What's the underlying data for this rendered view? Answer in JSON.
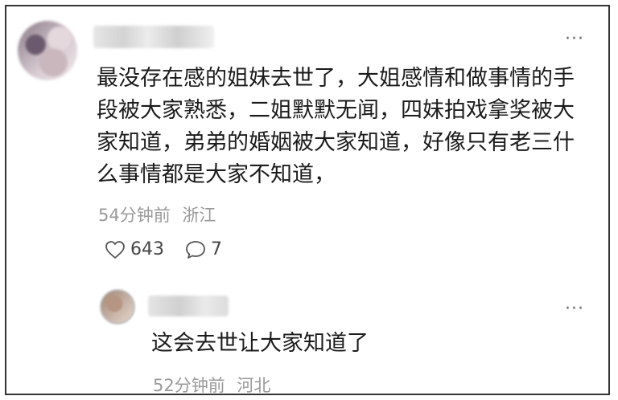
{
  "comment": {
    "text": "最没存在感的姐妹去世了，大姐感情和做事情的手段被大家熟悉，二姐默默无闻，四妹拍戏拿奖被大家知道，弟弟的婚姻被大家知道，好像只有老三什么事情都是大家不知道，",
    "time": "54分钟前",
    "location": "浙江",
    "likes": "643",
    "replies": "7",
    "more_label": "···",
    "like_icon": "heart-icon",
    "reply_icon": "comment-bubble-icon"
  },
  "reply": {
    "text": "这会去世让大家知道了",
    "time": "52分钟前",
    "location": "河北",
    "more_label": "···"
  }
}
